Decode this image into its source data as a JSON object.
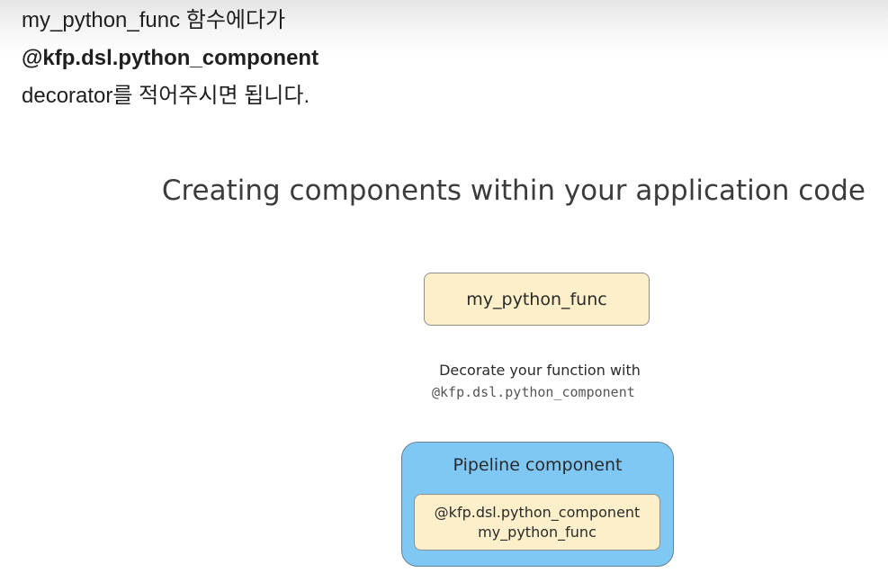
{
  "note": {
    "line1": "my_python_func 함수에다가",
    "line2": "@kfp.dsl.python_component",
    "line3": "decorator를 적어주시면 됩니다."
  },
  "slide": {
    "title": "Creating components within your application code",
    "func_box_label": "my_python_func",
    "decorate_text": "Decorate your function with",
    "decorate_code": "@kfp.dsl.python_component",
    "pipeline_title": "Pipeline component",
    "inner_line1": "@kfp.dsl.python_component",
    "inner_line2": "my_python_func"
  },
  "colors": {
    "cream_box": "#fcefc9",
    "pipeline_blue": "#7fc8f6"
  }
}
